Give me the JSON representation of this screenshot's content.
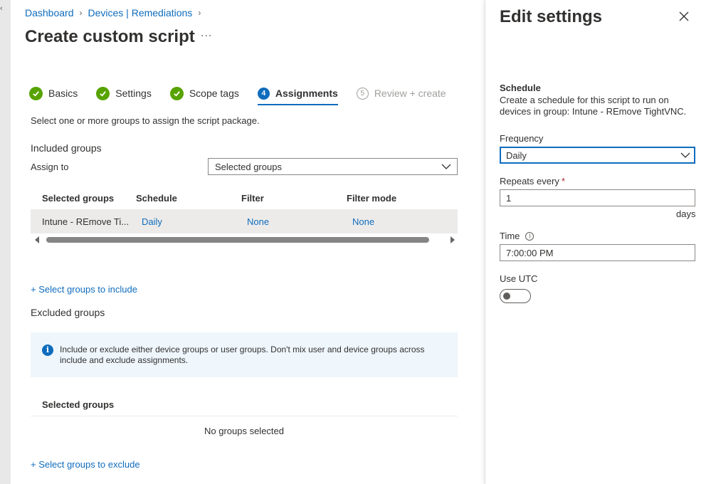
{
  "breadcrumb": {
    "items": [
      "Dashboard",
      "Devices | Remediations"
    ]
  },
  "page": {
    "title": "Create custom script",
    "more": "..."
  },
  "wizard": {
    "steps": [
      {
        "label": "Basics",
        "state": "done"
      },
      {
        "label": "Settings",
        "state": "done"
      },
      {
        "label": "Scope tags",
        "state": "done"
      },
      {
        "label": "Assignments",
        "state": "current",
        "number": "4"
      },
      {
        "label": "Review + create",
        "state": "future",
        "number": "5"
      }
    ]
  },
  "assignments": {
    "description": "Select one or more groups to assign the script package.",
    "included_title": "Included groups",
    "assign_to_label": "Assign to",
    "assign_to_value": "Selected groups",
    "table": {
      "headers": [
        "Selected groups",
        "Schedule",
        "Filter",
        "Filter mode"
      ],
      "rows": [
        [
          "Intune - REmove Ti...",
          "Daily",
          "None",
          "None"
        ]
      ]
    },
    "select_include_link": "+ Select groups to include",
    "excluded_title": "Excluded groups",
    "info_text": "Include or exclude either device groups or user groups. Don't mix user and device groups across include and exclude assignments.",
    "excluded_table_header": "Selected groups",
    "no_groups": "No groups selected",
    "select_exclude_link": "+ Select groups to exclude"
  },
  "panel": {
    "title": "Edit settings",
    "schedule_title": "Schedule",
    "schedule_desc": "Create a schedule for this script to run on devices in group: Intune - REmove TightVNC.",
    "frequency_label": "Frequency",
    "frequency_value": "Daily",
    "repeats_label": "Repeats every",
    "required_mark": "*",
    "repeats_value": "1",
    "repeats_unit": "days",
    "time_label": "Time",
    "time_value": "7:00:00 PM",
    "utc_label": "Use UTC",
    "utc_on": false
  },
  "colors": {
    "accent": "#0f6cbd",
    "success": "#57a300",
    "info_bg": "#eff6fc"
  }
}
